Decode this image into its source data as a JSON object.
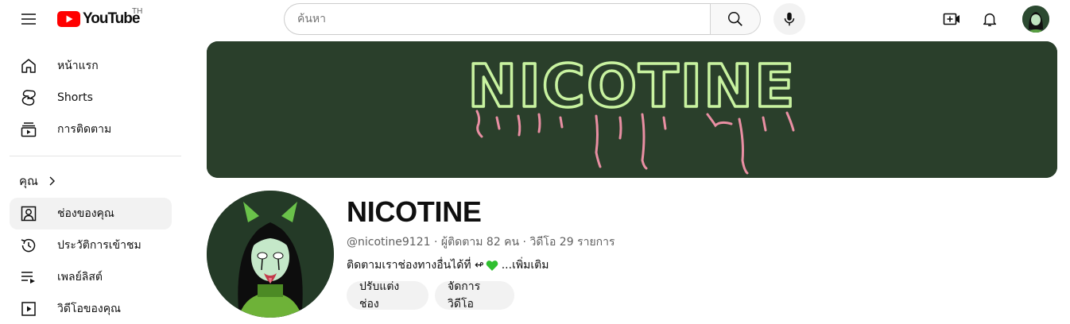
{
  "header": {
    "logo_text": "YouTube",
    "country_code": "TH",
    "search_placeholder": "ค้นหา"
  },
  "sidebar": {
    "items": [
      {
        "label": "หน้าแรก",
        "icon": "home-icon"
      },
      {
        "label": "Shorts",
        "icon": "shorts-icon"
      },
      {
        "label": "การติดตาม",
        "icon": "subscriptions-icon"
      }
    ],
    "you_header": "คุณ",
    "you_items": [
      {
        "label": "ช่องของคุณ",
        "icon": "your-channel-icon",
        "active": true
      },
      {
        "label": "ประวัติการเข้าชม",
        "icon": "history-icon"
      },
      {
        "label": "เพลย์ลิสต์",
        "icon": "playlists-icon"
      },
      {
        "label": "วิดีโอของคุณ",
        "icon": "your-videos-icon"
      }
    ]
  },
  "banner": {
    "text": "NICOTINE"
  },
  "channel": {
    "name": "NICOTINE",
    "handle": "@nicotine9121",
    "subscribers": "ผู้ติดตาม 82 คน",
    "videos": "วิดีโอ 29 รายการ",
    "separator": " · ",
    "description": "ติดตามเราช่องทางอื่นได้ที่ ↫",
    "more_label": "...เพิ่มเติม",
    "customize_label": "ปรับแต่งช่อง",
    "manage_label": "จัดการวิดีโอ"
  },
  "colors": {
    "banner_bg": "#2a3f2b",
    "banner_text": "#c8f2a0",
    "banner_drip": "#e98fa3",
    "youtube_red": "#ff0000"
  }
}
